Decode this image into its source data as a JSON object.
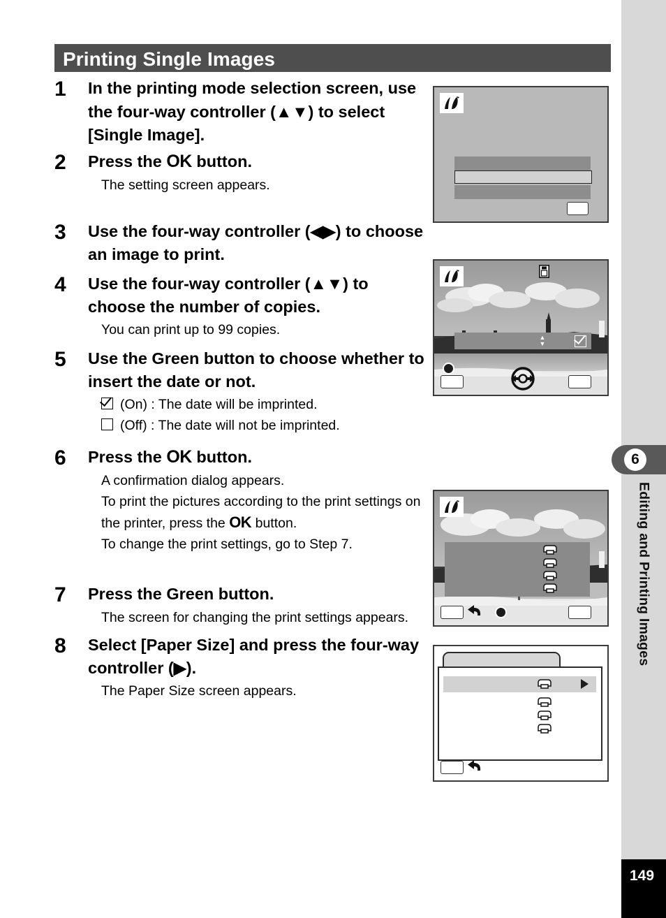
{
  "header": {
    "title": "Printing Single Images"
  },
  "sidebar": {
    "chapter_number": "6",
    "chapter_title": "Editing and Printing Images",
    "page_number": "149"
  },
  "steps": [
    {
      "number": "1",
      "title": "In the printing mode selection screen, use the four-way controller (▲▼) to select [Single Image].",
      "body": ""
    },
    {
      "number": "2",
      "title_prefix": "Press the ",
      "title_ok": "OK",
      "title_suffix": " button.",
      "body": "The setting screen appears."
    },
    {
      "number": "3",
      "title": "Use the four-way controller (◀▶) to choose an image to print.",
      "body": ""
    },
    {
      "number": "4",
      "title": "Use the four-way controller (▲▼) to choose the number of copies.",
      "body": "You can print up to 99 copies."
    },
    {
      "number": "5",
      "title": "Use the Green button to choose whether to insert the date or not.",
      "option_on": "(On) : The date will be imprinted.",
      "option_off": "(Off) : The date will not be imprinted."
    },
    {
      "number": "6",
      "title_prefix": "Press the ",
      "title_ok": "OK",
      "title_suffix": " button.",
      "body_line1": "A confirmation dialog appears.",
      "body_line2": "To print the pictures according to the print settings on the printer, press the ",
      "body_ok": "OK",
      "body_line3": " button.",
      "body_line4": "To change the print settings, go to Step 7."
    },
    {
      "number": "7",
      "title": "Press the Green button.",
      "body": "The screen for changing the print settings appears."
    },
    {
      "number": "8",
      "title": "Select [Paper Size] and press the four-way controller (▶).",
      "body": "The Paper Size screen appears."
    }
  ],
  "screens": {
    "screen1": {
      "name": "printing-mode-selection-screen"
    },
    "screen2": {
      "name": "image-and-copies-screen"
    },
    "screen3": {
      "name": "print-confirmation-screen"
    },
    "screen4": {
      "name": "print-settings-menu-screen"
    }
  },
  "colors": {
    "header_bar": "#4e4e4e",
    "sidebar": "#d8d8d8",
    "chapter_tab": "#595959",
    "page_block": "#000000",
    "screen_bg": "#b9b9b9"
  }
}
